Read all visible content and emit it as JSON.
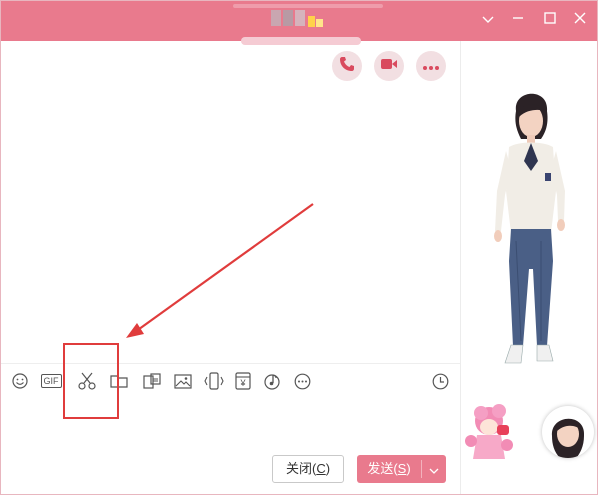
{
  "titlebar": {
    "background": "#e97a8d",
    "controls": [
      "chevron-down-icon",
      "minimize-icon",
      "maximize-icon",
      "close-icon"
    ]
  },
  "call_actions": [
    {
      "name": "phone-call-icon"
    },
    {
      "name": "video-call-icon"
    },
    {
      "name": "more-options-icon"
    }
  ],
  "toolbar": {
    "gif_label": "GIF",
    "yen_label": "¥",
    "icons": [
      "emoji-icon",
      "gif-icon",
      "screenshot-scissors-icon",
      "folder-icon",
      "screenshot-edit-icon",
      "image-icon",
      "shake-icon",
      "red-packet-icon",
      "music-icon",
      "more-icon",
      "history-clock-icon"
    ]
  },
  "footer": {
    "close_label": "关闭",
    "close_key": "C",
    "send_label": "发送",
    "send_key": "S"
  },
  "colors": {
    "accent": "#e97a8d",
    "highlight": "#e03c3c"
  }
}
